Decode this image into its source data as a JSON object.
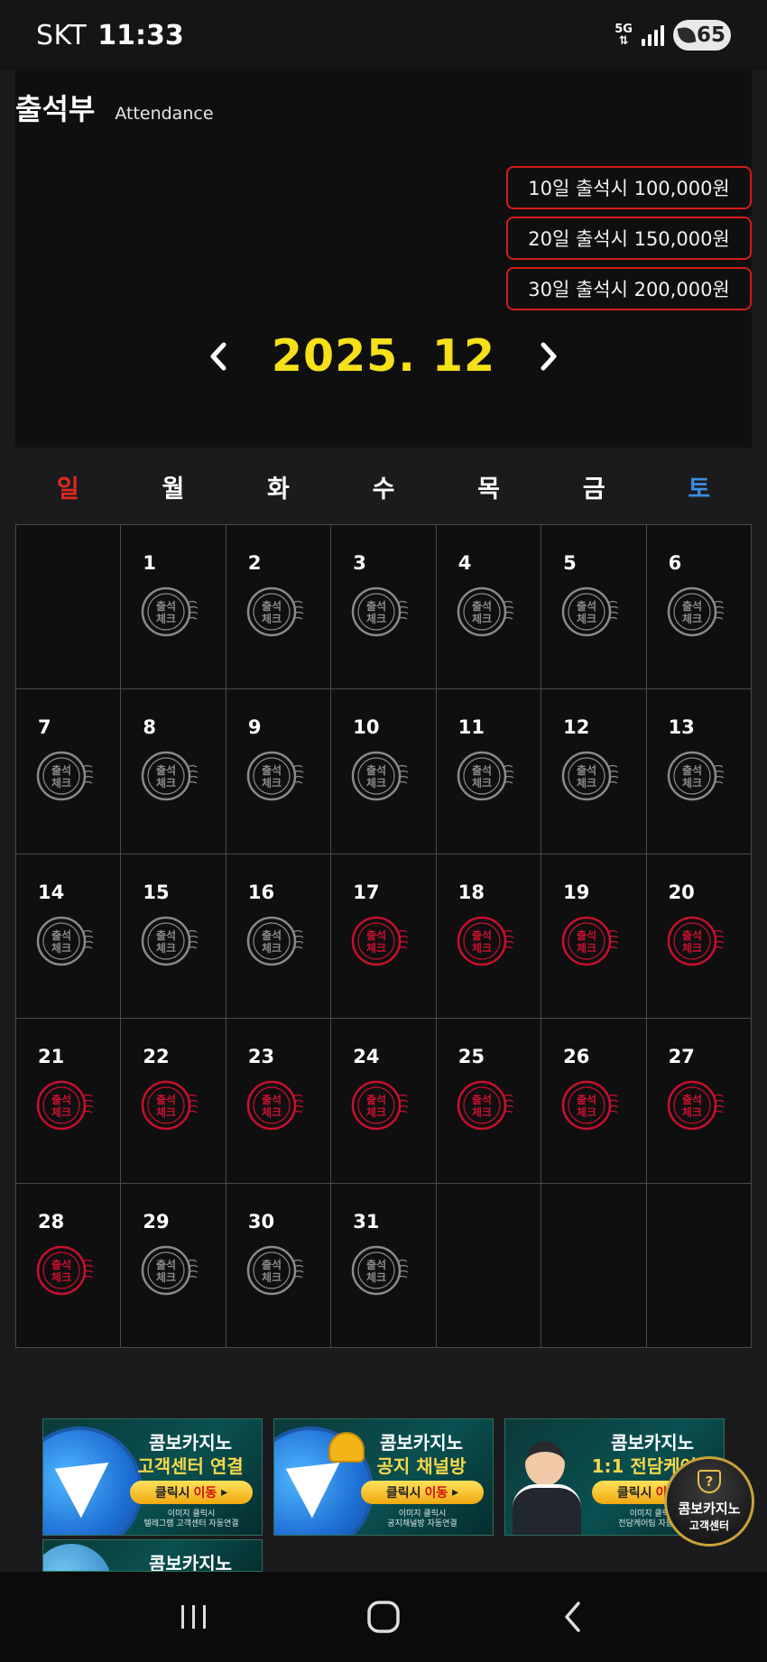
{
  "statusbar": {
    "carrier": "SKT",
    "time": "11:33",
    "network": "5G",
    "battery": "65"
  },
  "header": {
    "title_ko": "출석부",
    "title_en": "Attendance"
  },
  "rewards": [
    {
      "label": "10일 출석시 100,000원"
    },
    {
      "label": "20일 출석시 150,000원"
    },
    {
      "label": "30일 출석시 200,000원"
    }
  ],
  "month_nav": {
    "month": "2025. 12",
    "prev_icon": "chevron-left-icon",
    "next_icon": "chevron-right-icon"
  },
  "weekdays": [
    "일",
    "월",
    "화",
    "수",
    "목",
    "금",
    "토"
  ],
  "calendar": {
    "stamp_text_line1": "출석",
    "stamp_text_line2": "체크",
    "checked_days": [
      17,
      18,
      19,
      20,
      21,
      22,
      23,
      24,
      25,
      26,
      27,
      28
    ],
    "first_weekday_index": 1,
    "days_in_month": 31
  },
  "banners": [
    {
      "line1": "콤보카지노",
      "line2": "고객센터 연결",
      "button": "클릭시",
      "button_em": "이동",
      "note1": "이미지 클릭시",
      "note2": "텔레그램 고객센터 자동연결",
      "icon": "telegram-icon"
    },
    {
      "line1": "콤보카지노",
      "line2": "공지 채널방",
      "button": "클릭시",
      "button_em": "이동",
      "note1": "이미지 클릭시",
      "note2": "공지채널방 자동연결",
      "icon": "bell-icon"
    },
    {
      "line1": "콤보카지노",
      "line2": "1:1 전담케어팀",
      "button": "클릭시",
      "button_em": "이동",
      "note1": "이미지 클릭시",
      "note2": "전담케어팀 자동연결",
      "icon": "agent-icon"
    }
  ],
  "partial_banner": {
    "line1": "콤보카지노"
  },
  "cs_badge": {
    "line1": "콤보카지노",
    "line2": "고객센터"
  },
  "colors": {
    "accent_yellow": "#f5e019",
    "reward_border": "#d41b1b",
    "sunday": "#e2281f",
    "saturday": "#3a8ee0",
    "stamp_checked": "#c8102e",
    "stamp_unchecked": "#8a8a8a"
  },
  "navbar": {
    "recent_icon": "recent-apps-icon",
    "home_icon": "home-icon",
    "back_icon": "back-icon"
  }
}
